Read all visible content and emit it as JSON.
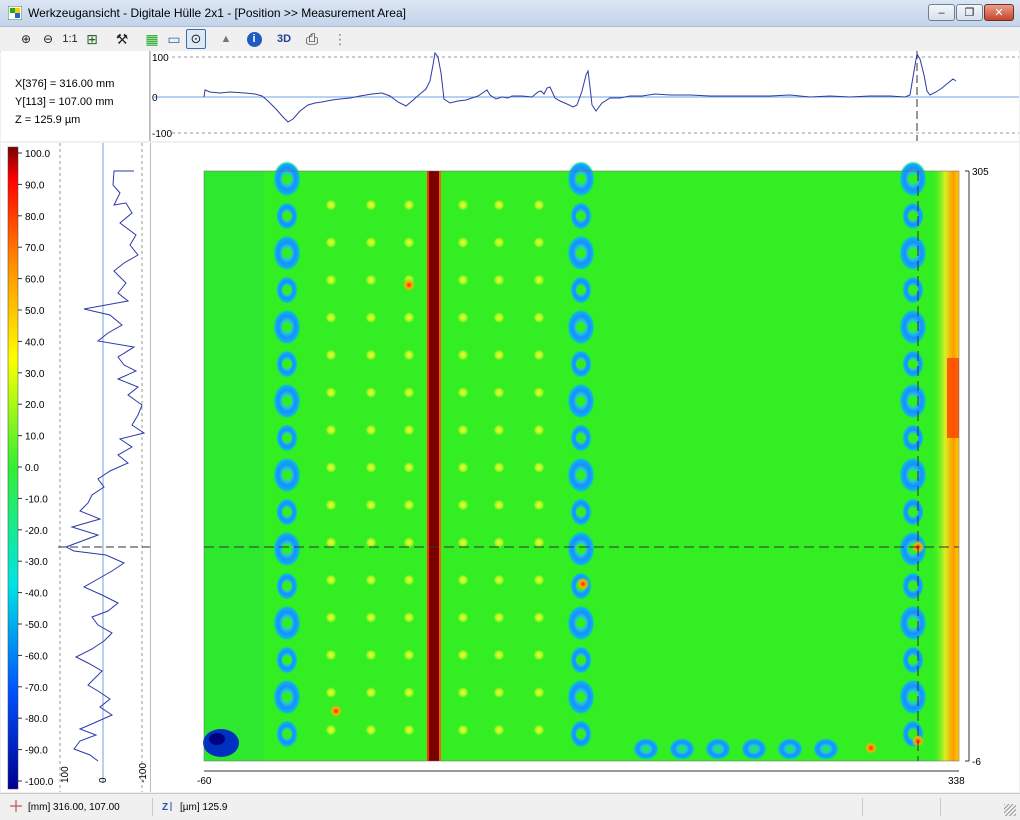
{
  "window": {
    "title": "Werkzeugansicht - Digitale Hülle 2x1 - [Position >> Measurement Area]",
    "minimize_glyph": "–",
    "restore_glyph": "❐",
    "close_glyph": "✕"
  },
  "toolbar": {
    "items": [
      {
        "icon": "zoom-in-icon",
        "glyph": "⊕"
      },
      {
        "icon": "zoom-out-icon",
        "glyph": "⊖"
      },
      {
        "icon": "zoom-1to1",
        "label": "1:1"
      },
      {
        "icon": "fit-view-icon",
        "glyph": "⊞"
      },
      {
        "icon": "tools-icon",
        "glyph": "⚒"
      },
      {
        "icon": "height-map-icon",
        "glyph": "▦"
      },
      {
        "icon": "profile-icon",
        "glyph": "▭"
      },
      {
        "icon": "position-icon",
        "glyph": "⊙"
      },
      {
        "icon": "light-icon",
        "glyph": "▲"
      },
      {
        "icon": "info-icon",
        "glyph": "i"
      },
      {
        "icon": "view-3d",
        "label": "3D"
      },
      {
        "icon": "print-icon",
        "glyph": "⎙"
      },
      {
        "icon": "more-icon",
        "glyph": "⋮"
      }
    ]
  },
  "cursor_info": {
    "x": "X[376] = 316.00 mm",
    "y": "Y[113] = 107.00 mm",
    "z": "Z = 125.9 µm"
  },
  "top_profile": {
    "y_ticks": [
      "100",
      "0",
      "-100"
    ]
  },
  "left_profile": {
    "x_ticks": [
      "100",
      "0",
      "-100"
    ]
  },
  "color_scale": {
    "ticks": [
      "100.0",
      "90.0",
      "80.0",
      "70.0",
      "60.0",
      "50.0",
      "40.0",
      "30.0",
      "20.0",
      "10.0",
      "0.0",
      "-10.0",
      "-20.0",
      "-30.0",
      "-40.0",
      "-50.0",
      "-60.0",
      "-70.0",
      "-80.0",
      "-90.0",
      "-100.0"
    ],
    "colors": [
      "#7a0000",
      "#ff0000",
      "#ff8c00",
      "#ffff00",
      "#33ee33",
      "#00e5e5",
      "#0050ff",
      "#000090"
    ]
  },
  "height_map": {
    "x_min": "-60",
    "x_max": "338",
    "y_max": "305",
    "y_min": "-6",
    "background_color": "#33ee22"
  },
  "status": {
    "position": "[mm] 316.00, 107.00",
    "value": "[µm] 125.9"
  }
}
